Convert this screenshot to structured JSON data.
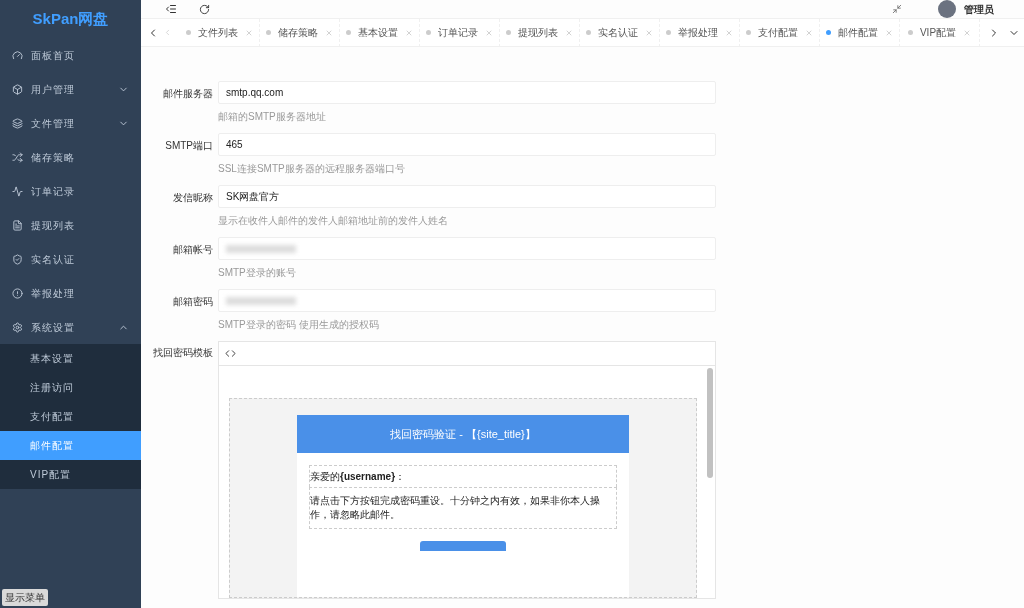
{
  "sidebar": {
    "logo": "SkPan网盘",
    "items": [
      {
        "label": "面板首页"
      },
      {
        "label": "用户管理",
        "expanded": false
      },
      {
        "label": "文件管理",
        "expanded": false
      },
      {
        "label": "储存策略"
      },
      {
        "label": "订单记录"
      },
      {
        "label": "提现列表"
      },
      {
        "label": "实名认证"
      },
      {
        "label": "举报处理"
      },
      {
        "label": "系统设置",
        "expanded": true,
        "children": [
          {
            "label": "基本设置",
            "selected": false
          },
          {
            "label": "注册访问",
            "selected": false
          },
          {
            "label": "支付配置",
            "selected": false
          },
          {
            "label": "邮件配置",
            "selected": true
          },
          {
            "label": "VIP配置",
            "selected": false
          }
        ]
      }
    ],
    "toggle_button": "显示菜单"
  },
  "header": {
    "user": "管理员"
  },
  "tabs": [
    {
      "label": "文件列表",
      "selected": false
    },
    {
      "label": "储存策略",
      "selected": false
    },
    {
      "label": "基本设置",
      "selected": false
    },
    {
      "label": "订单记录",
      "selected": false
    },
    {
      "label": "提现列表",
      "selected": false
    },
    {
      "label": "实名认证",
      "selected": false
    },
    {
      "label": "举报处理",
      "selected": false
    },
    {
      "label": "支付配置",
      "selected": false
    },
    {
      "label": "邮件配置",
      "selected": true
    },
    {
      "label": "VIP配置",
      "selected": false
    }
  ],
  "form": [
    {
      "label": "邮件服务器",
      "kind": "text",
      "value": "smtp.qq.com",
      "hint": "邮箱的SMTP服务器地址"
    },
    {
      "label": "SMTP端口",
      "kind": "text",
      "value": "465",
      "hint": "SSL连接SMTP服务器的远程服务器端口号"
    },
    {
      "label": "发信昵称",
      "kind": "text",
      "value": "SK网盘官方",
      "hint": "显示在收件人邮件的发件人邮箱地址前的发件人姓名"
    },
    {
      "label": "邮箱帐号",
      "kind": "masked",
      "hint": "SMTP登录的账号"
    },
    {
      "label": "邮箱密码",
      "kind": "masked",
      "hint": "SMTP登录的密码 使用生成的授权码"
    }
  ],
  "template": {
    "label": "找回密码模板",
    "email_title": "找回密码验证 - 【{site_title}】",
    "greeting": "亲爱的**{username}**：",
    "body": "请点击下方按钮完成密码重设。十分钟之内有效，如果非你本人操作，请忽略此邮件。"
  }
}
